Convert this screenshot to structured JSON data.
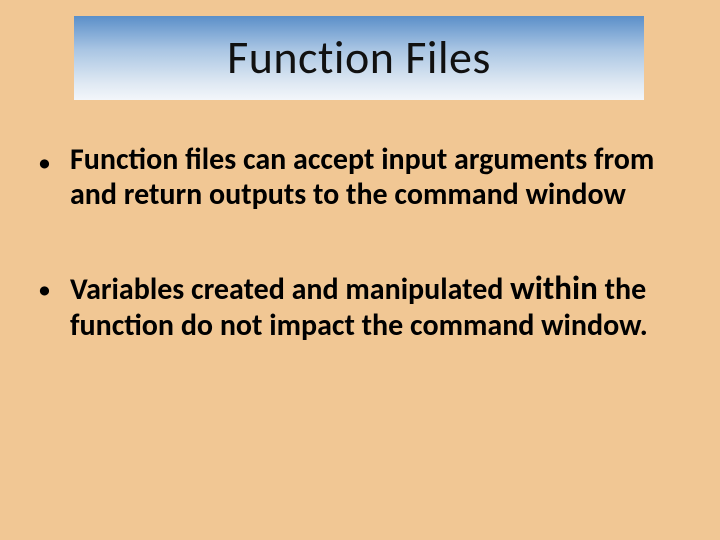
{
  "title": "Function Files",
  "bullets": {
    "0": {
      "marker": "•",
      "text": "Function files can accept input arguments from and return outputs to the command window"
    },
    "1": {
      "marker": "•",
      "prefix": "Variables created and manipulated ",
      "emph": "within",
      "suffix": " the function do not impact the command window."
    }
  }
}
